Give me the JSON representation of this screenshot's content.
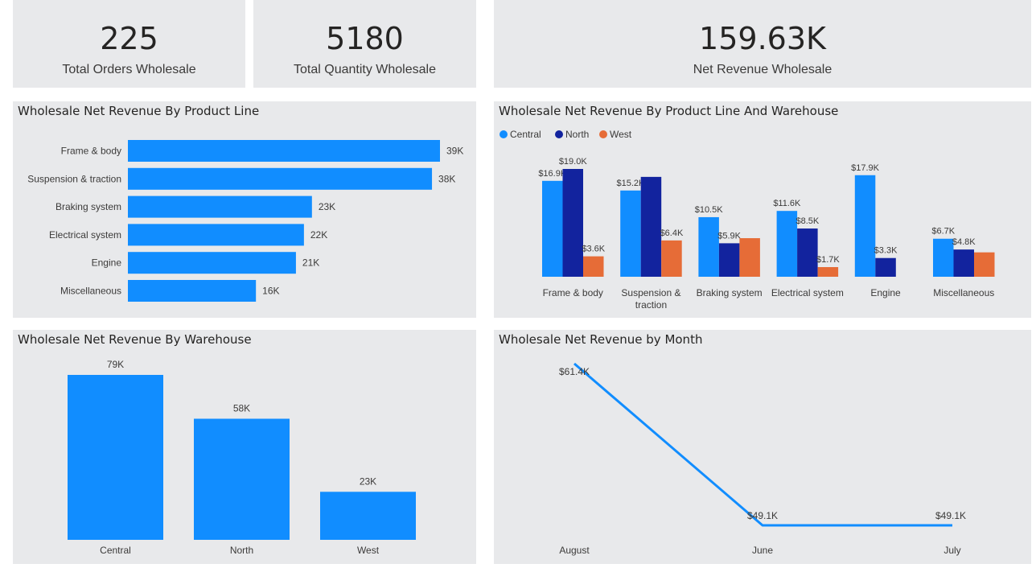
{
  "colors": {
    "central": "#118dff",
    "north": "#12239e",
    "west": "#e66c37",
    "card_bg": "#e8e9eb"
  },
  "kpis": [
    {
      "value": "225",
      "label": "Total Orders Wholesale"
    },
    {
      "value": "5180",
      "label": "Total Quantity Wholesale"
    },
    {
      "value": "159.63K",
      "label": "Net Revenue Wholesale"
    }
  ],
  "charts": {
    "product_line": {
      "title": "Wholesale Net Revenue By Product Line"
    },
    "product_line_warehouse": {
      "title": "Wholesale Net Revenue By Product Line And Warehouse",
      "legend": [
        "Central",
        "North",
        "West"
      ]
    },
    "warehouse": {
      "title": "Wholesale Net Revenue By Warehouse"
    },
    "month": {
      "title": "Wholesale Net Revenue by Month"
    }
  },
  "chart_data": [
    {
      "id": "product_line",
      "type": "bar",
      "orientation": "horizontal",
      "categories": [
        "Frame & body",
        "Suspension & traction",
        "Braking system",
        "Electrical system",
        "Engine",
        "Miscellaneous"
      ],
      "values": [
        39,
        38,
        23,
        22,
        21,
        16
      ],
      "labels": [
        "39K",
        "38K",
        "23K",
        "22K",
        "21K",
        "16K"
      ],
      "xlim": [
        0,
        39
      ]
    },
    {
      "id": "product_line_warehouse",
      "type": "bar",
      "categories": [
        "Frame & body",
        "Suspension & traction",
        "Braking system",
        "Electrical system",
        "Engine",
        "Miscellaneous"
      ],
      "series": [
        {
          "name": "Central",
          "values": [
            16.9,
            15.2,
            10.5,
            11.6,
            17.9,
            6.7
          ],
          "labels": [
            "$16.9K",
            "$15.2K",
            "$10.5K",
            "$11.6K",
            "$17.9K",
            "$6.7K"
          ]
        },
        {
          "name": "North",
          "values": [
            19.0,
            17.6,
            5.9,
            8.5,
            3.3,
            4.8
          ],
          "labels": [
            "$19.0K",
            "",
            "$5.9K",
            "$8.5K",
            "$3.3K",
            "$4.8K"
          ]
        },
        {
          "name": "West",
          "values": [
            3.6,
            6.4,
            6.8,
            1.7,
            null,
            4.3
          ],
          "labels": [
            "$3.6K",
            "$6.4K",
            "",
            "$1.7K",
            "",
            ""
          ]
        }
      ],
      "legend_position": "top-left",
      "ylim": [
        0,
        19.0
      ]
    },
    {
      "id": "warehouse",
      "type": "bar",
      "categories": [
        "Central",
        "North",
        "West"
      ],
      "values": [
        79,
        58,
        23
      ],
      "labels": [
        "79K",
        "58K",
        "23K"
      ],
      "ylim": [
        0,
        79
      ]
    },
    {
      "id": "month",
      "type": "line",
      "x": [
        "August",
        "June",
        "July"
      ],
      "values": [
        61.4,
        49.1,
        49.1
      ],
      "labels": [
        "$61.4K",
        "$49.1K",
        "$49.1K"
      ],
      "ylim": [
        49.1,
        61.4
      ]
    }
  ]
}
